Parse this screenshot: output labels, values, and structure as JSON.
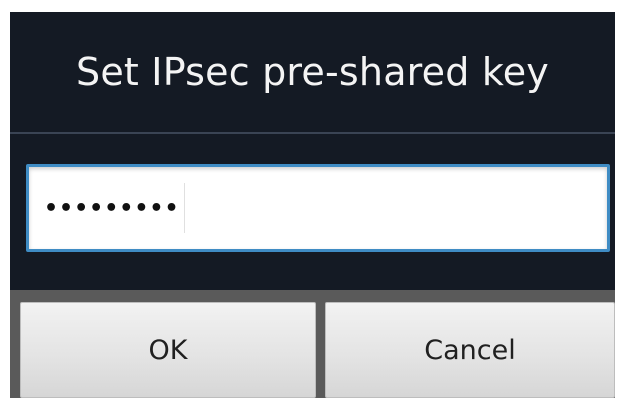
{
  "dialog": {
    "title": "Set IPsec pre-shared key",
    "password_field": {
      "masked_value": "•••••••••",
      "focused": true
    },
    "buttons": {
      "ok_label": "OK",
      "cancel_label": "Cancel"
    }
  },
  "colors": {
    "title_background": "#141a24",
    "title_text": "#f4f4f4",
    "field_focus_border": "#3f8cc4",
    "button_background": "#e4e4e4",
    "button_text": "#202020"
  }
}
